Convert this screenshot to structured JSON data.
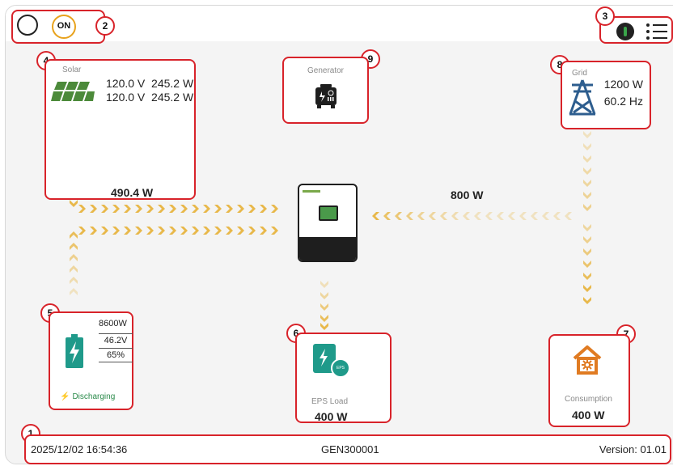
{
  "markers": [
    "1",
    "2",
    "3",
    "4",
    "5",
    "6",
    "7",
    "8",
    "9"
  ],
  "header": {
    "power_state": "ON"
  },
  "solar": {
    "caption": "Solar",
    "row1": "120.0 V  245.2 W",
    "row2": "120.0 V  245.2 W",
    "total": "490.4 W"
  },
  "generator": {
    "caption": "Generator"
  },
  "grid": {
    "caption": "Grid",
    "power": "1200 W",
    "frequency": "60.2 Hz"
  },
  "flow": {
    "grid_to_inverter": "800 W"
  },
  "battery": {
    "power": "8600W",
    "voltage": "46.2V",
    "soc": "65%",
    "status": "Discharging"
  },
  "eps": {
    "caption": "EPS Load",
    "power": "400 W",
    "badge": "EPS"
  },
  "consumption": {
    "caption": "Consumption",
    "power": "400 W"
  },
  "footer": {
    "datetime": "2025/12/02 16:54:36",
    "serial": "GEN300001",
    "version": "Version: 01.01"
  },
  "colors": {
    "accent_red": "#d8232a",
    "flow_gold": "#e8b84a",
    "solar_green": "#4c8a3a",
    "battery_teal": "#1f9a8a",
    "grid_blue": "#2d5d8e",
    "consumption_orange": "#e07b22"
  }
}
